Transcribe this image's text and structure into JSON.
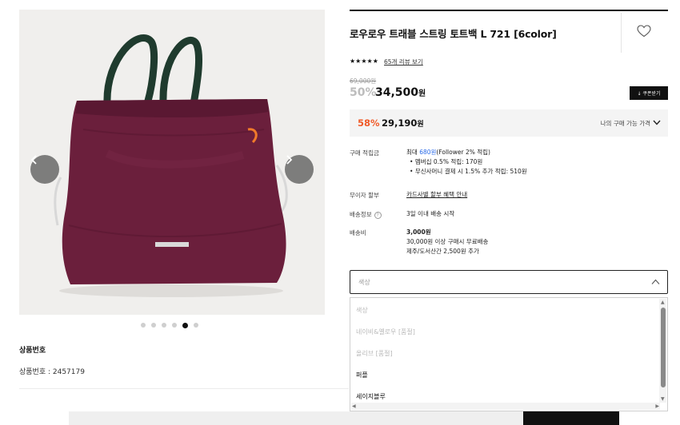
{
  "gallery": {
    "slide_count": 6,
    "active_slide": 5
  },
  "product_code": {
    "title": "상품번호",
    "value": "상품번호 : 2457179"
  },
  "product": {
    "title": "로우로우 트래블 스트링 토트백 L 721 [6color]",
    "rating": 4.5,
    "stars": "★★★★★",
    "review_link": "65개 리뷰 보기",
    "original_price": "69,000원",
    "discount": "50%",
    "price": "34,500",
    "price_unit": "원",
    "coupon_label": "↓ 쿠폰받기"
  },
  "promo": {
    "discount": "58%",
    "price": "29,190",
    "price_unit": "원",
    "note": "나의 구매 가능 가격"
  },
  "info_rows": {
    "points": {
      "label": "구매 적립금",
      "prefix": "최대 ",
      "amount": "680원",
      "suffix": "(Follower 2% 적립)",
      "bullets": [
        "멤버십 0.5% 적립: 170원",
        "무신사머니 결제 시 1.5% 추가 적립: 510원"
      ]
    },
    "installment": {
      "label": "무이자 할부",
      "value": "카드사별 할부 혜택 안내"
    },
    "shipping_info": {
      "label": "배송정보",
      "value": "3일 이내 배송 시작"
    },
    "shipping_fee": {
      "label": "배송비",
      "amount": "3,000원",
      "lines": [
        "30,000원 이상 구매시 무료배송",
        "제주/도서산간 2,500원 추가"
      ]
    }
  },
  "color_select": {
    "placeholder": "색상",
    "options": [
      {
        "label": "색상",
        "disabled": true
      },
      {
        "label": "네이비&옐로우 [품절]",
        "disabled": true
      },
      {
        "label": "올리브 [품절]",
        "disabled": true
      },
      {
        "label": "퍼플",
        "disabled": false
      },
      {
        "label": "세이지블루",
        "disabled": false
      }
    ]
  },
  "colors": {
    "accent_orange": "#f05a28",
    "link_blue": "#2b6be8",
    "bag_purple": "#6b1f3c",
    "handle_green": "#1f3b2e"
  }
}
